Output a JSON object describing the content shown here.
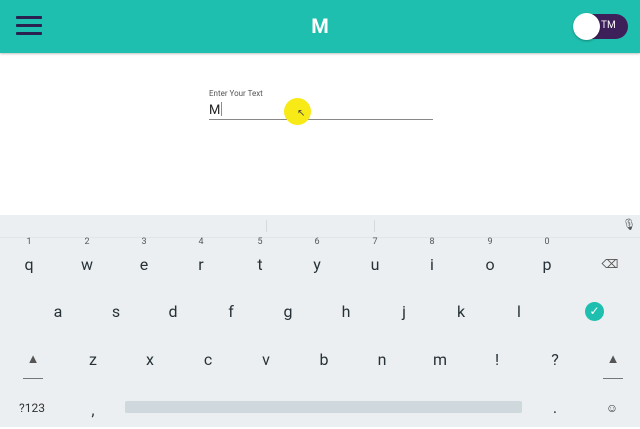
{
  "appbar": {
    "title": "M",
    "toggle_label": "TM",
    "toggle_on": true,
    "color": "#1ebfae"
  },
  "field": {
    "label": "Enter Your Text",
    "value": "M"
  },
  "keyboard": {
    "row1": [
      {
        "key": "q",
        "num": "1"
      },
      {
        "key": "w",
        "num": "2"
      },
      {
        "key": "e",
        "num": "3"
      },
      {
        "key": "r",
        "num": "4"
      },
      {
        "key": "t",
        "num": "5"
      },
      {
        "key": "y",
        "num": "6"
      },
      {
        "key": "u",
        "num": "7"
      },
      {
        "key": "i",
        "num": "8"
      },
      {
        "key": "o",
        "num": "9"
      },
      {
        "key": "p",
        "num": "0"
      }
    ],
    "row2": [
      "a",
      "s",
      "d",
      "f",
      "g",
      "h",
      "j",
      "k",
      "l"
    ],
    "row3": [
      "z",
      "x",
      "c",
      "v",
      "b",
      "n",
      "m",
      "!",
      "?"
    ],
    "symbols_label": "?123",
    "comma": ",",
    "period": ".",
    "enter_icon": "check-icon",
    "emoji_icon": "emoji-icon",
    "mic_icon": "mic-icon"
  }
}
